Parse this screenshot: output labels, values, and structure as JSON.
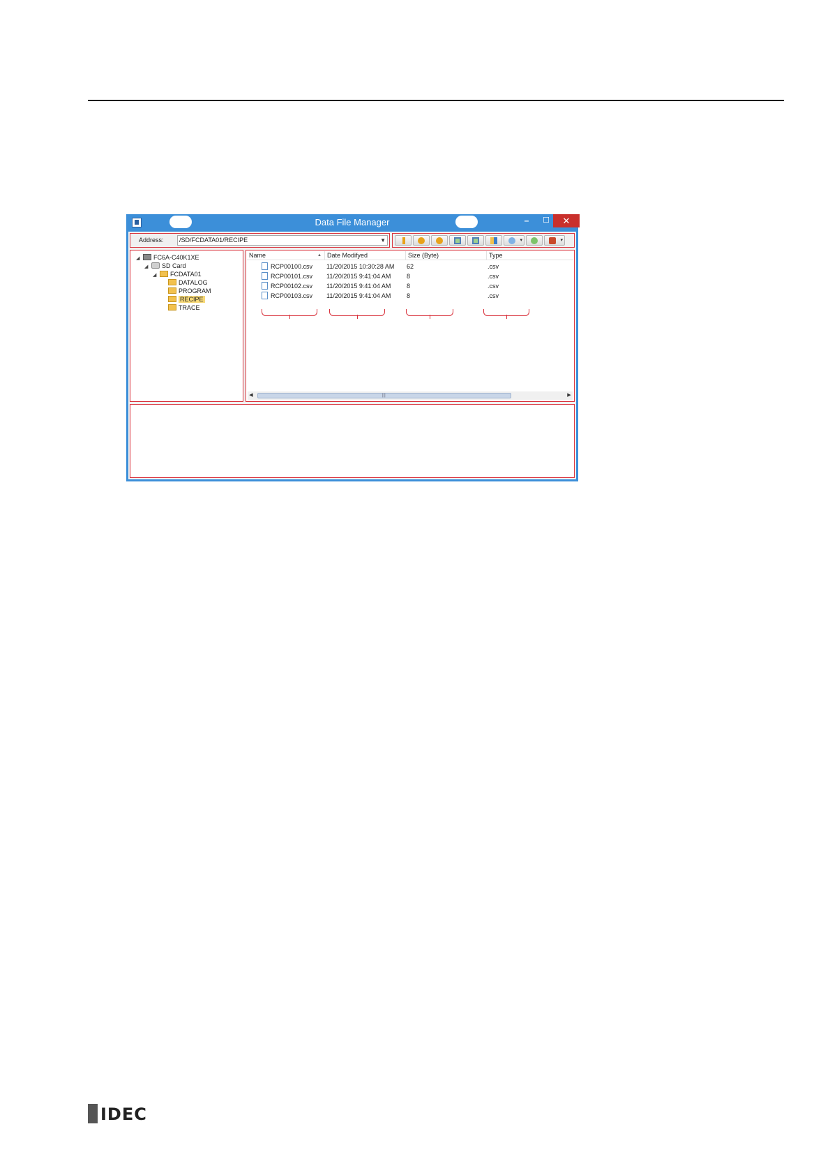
{
  "window": {
    "title": "Data File Manager",
    "min_glyph": "–",
    "max_glyph": "☐",
    "close_glyph": "✕"
  },
  "address": {
    "label": "Address:",
    "value": "/SD/FCDATA01/RECIPE"
  },
  "toolbar": {
    "buttons": [
      {
        "icon": "download-arrow-icon",
        "color": "#e8a21a"
      },
      {
        "icon": "play-icon",
        "color": "#e8a21a"
      },
      {
        "icon": "stop-icon",
        "color": "#e8a21a"
      },
      {
        "icon": "export-icon",
        "color": "#5a9a5a"
      },
      {
        "icon": "import-icon",
        "color": "#5a9a5a"
      },
      {
        "icon": "compare-icon",
        "color": "#3b7ec9"
      },
      {
        "icon": "undo-dropdown-icon",
        "color": "#3b7ec9"
      },
      {
        "icon": "refresh-icon",
        "color": "#5aa84a"
      },
      {
        "icon": "tools-dropdown-icon",
        "color": "#c94a2a"
      }
    ]
  },
  "tree": {
    "nodes": [
      {
        "label": "FC6A-C40K1XE",
        "icon": "plc-icon",
        "expanded": true
      },
      {
        "label": "SD Card",
        "icon": "sd-card-icon",
        "expanded": true
      },
      {
        "label": "FCDATA01",
        "icon": "folder-icon",
        "expanded": true
      },
      {
        "label": "DATALOG",
        "icon": "folder-icon"
      },
      {
        "label": "PROGRAM",
        "icon": "folder-icon"
      },
      {
        "label": "RECIPE",
        "icon": "folder-icon",
        "selected": true
      },
      {
        "label": "TRACE",
        "icon": "folder-icon"
      }
    ]
  },
  "files": {
    "columns": [
      "Name",
      "Date Modifyed",
      "Size (Byte)",
      "Type"
    ],
    "rows": [
      {
        "name": "RCP00100.csv",
        "date": "11/20/2015 10:30:28 AM",
        "size": "62",
        "type": ".csv"
      },
      {
        "name": "RCP00101.csv",
        "date": "11/20/2015 9:41:04 AM",
        "size": "8",
        "type": ".csv"
      },
      {
        "name": "RCP00102.csv",
        "date": "11/20/2015 9:41:04 AM",
        "size": "8",
        "type": ".csv"
      },
      {
        "name": "RCP00103.csv",
        "date": "11/20/2015 9:41:04 AM",
        "size": "8",
        "type": ".csv"
      }
    ]
  },
  "footer": {
    "logo_text": "IDEC"
  }
}
